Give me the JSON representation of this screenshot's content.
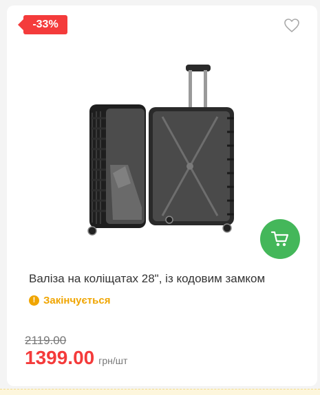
{
  "product": {
    "discount_badge": "-33%",
    "title": "Валіза на коліщатах 28\", із кодовим замком",
    "stock_status": "Закінчується",
    "stock_icon": "!",
    "old_price": "2119.00",
    "price": "1399.00",
    "unit": "грн/шт"
  },
  "icons": {
    "wishlist": "heart-icon",
    "cart": "cart-icon",
    "stock": "exclamation-icon"
  },
  "colors": {
    "discount": "#f43b3b",
    "price": "#f43b3b",
    "cart_button": "#44b75a",
    "stock_warning": "#f0a500"
  }
}
